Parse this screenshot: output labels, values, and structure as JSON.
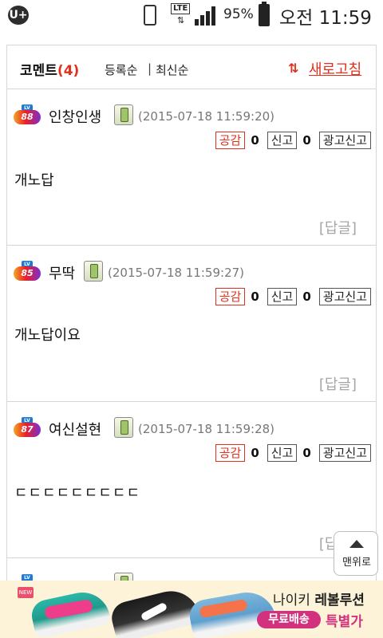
{
  "statusbar": {
    "carrier_logo": "U+",
    "lte": "LTE",
    "arrows": "⇅",
    "battery": "95%",
    "time": "오전 11:59",
    "icons": [
      "vibrate-icon",
      "lte-icon",
      "signal-icon",
      "battery-icon"
    ]
  },
  "header": {
    "title": "코멘트",
    "count": "(4)",
    "sort_registered": "등록순",
    "separator": "|",
    "sort_latest": "최신순",
    "refresh": "새로고침"
  },
  "comments": [
    {
      "level": "88",
      "author": "인창인생",
      "timestamp": "(2015-07-18 11:59:20)",
      "empathy_label": "공감",
      "empathy_count": "0",
      "report_label": "신고",
      "report_count": "0",
      "ad_report_label": "광고신고",
      "text": "개노답",
      "reply_label": "[답글]"
    },
    {
      "level": "85",
      "author": "무딱",
      "timestamp": "(2015-07-18 11:59:27)",
      "empathy_label": "공감",
      "empathy_count": "0",
      "report_label": "신고",
      "report_count": "0",
      "ad_report_label": "광고신고",
      "text": "개노답이요",
      "reply_label": "[답글]"
    },
    {
      "level": "87",
      "author": "여신설현",
      "timestamp": "(2015-07-18 11:59:28)",
      "empathy_label": "공감",
      "empathy_count": "0",
      "report_label": "신고",
      "report_count": "0",
      "ad_report_label": "광고신고",
      "text": "ㄷㄷㄷㄷㄷㄷㄷㄷㄷ",
      "reply_label": "[답글]"
    }
  ],
  "to_top": {
    "label": "맨위로"
  },
  "ad": {
    "new_badge": "NEW",
    "line1_a": "나이키 ",
    "line1_b": "레볼루션",
    "pill": "무료배송",
    "line2": "특별가"
  },
  "colors": {
    "accent_red": "#e0301e",
    "ad_pink": "#d2317e",
    "ad_background": "#fcf3d8"
  }
}
